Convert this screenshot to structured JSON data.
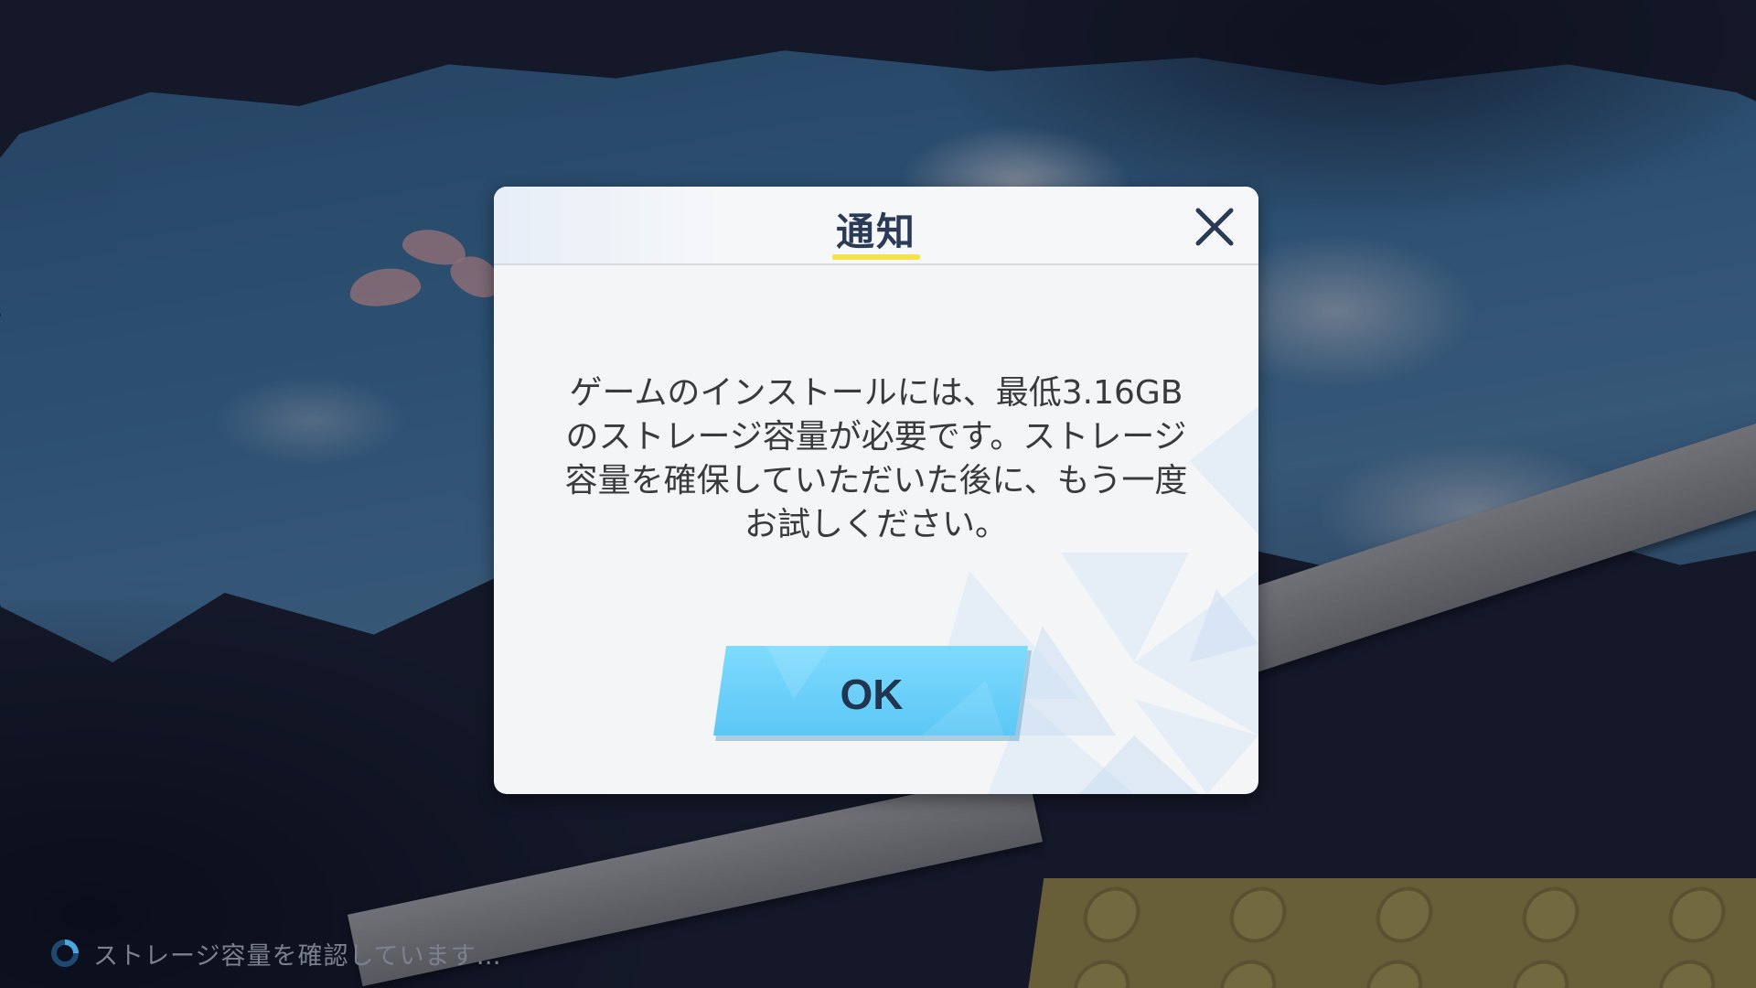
{
  "dialog": {
    "title": "通知",
    "message": "ゲームのインストールには、最低3.16GB\nのストレージ容量が必要です。ストレージ\n容量を確保していただいた後に、もう一度\nお試しください。",
    "ok_label": "OK",
    "close_icon": "close-icon"
  },
  "status": {
    "text": "ストレージ容量を確認しています…",
    "icon": "loading-spinner-icon"
  },
  "colors": {
    "title_accent": "#f6e34a",
    "button_fill": "#6fd3fb",
    "title_text": "#2b3a55"
  }
}
